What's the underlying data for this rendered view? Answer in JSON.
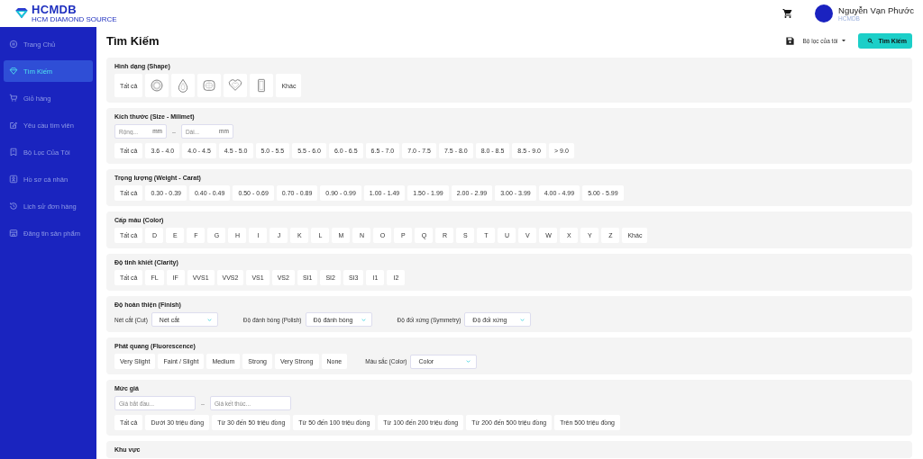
{
  "header": {
    "logo_text": "HCMDB",
    "logo_tagline": "HCM DIAMOND SOURCE",
    "user_name": "Nguyễn Vạn Phước",
    "user_org": "HCMDB"
  },
  "sidebar": {
    "items": [
      {
        "label": "Trang Chủ",
        "selected": false
      },
      {
        "label": "Tìm Kiếm",
        "selected": true
      },
      {
        "label": "Giỏ hàng",
        "selected": false
      },
      {
        "label": "Yêu cầu tìm viên",
        "selected": false
      },
      {
        "label": "Bộ Lọc Của Tôi",
        "selected": false
      },
      {
        "label": "Hồ sơ cá nhân",
        "selected": false
      },
      {
        "label": "Lịch sử đơn hàng",
        "selected": false
      },
      {
        "label": "Đăng tin sản phẩm",
        "selected": false
      }
    ]
  },
  "page": {
    "title": "Tìm Kiếm",
    "filters_menu": "Bộ lọc của tôi",
    "search_button": "Tìm Kiếm"
  },
  "sections": [
    {
      "title": "Hình dạng (Shape)",
      "options": [
        {
          "kind": "text",
          "label": "Tất cả"
        },
        {
          "kind": "icon"
        },
        {
          "kind": "icon"
        },
        {
          "kind": "icon"
        },
        {
          "kind": "icon"
        },
        {
          "kind": "icon"
        },
        {
          "kind": "text",
          "label": "Khác"
        }
      ]
    },
    {
      "title": "Kích thước (Size - Milimet)",
      "inputs": [
        {
          "placeholder": "Rộng...",
          "unit": "mm"
        },
        {
          "placeholder": "Dài...",
          "unit": "mm"
        }
      ],
      "separator": "–",
      "options": [
        {
          "kind": "text",
          "label": "Tất cả"
        },
        {
          "kind": "text",
          "label": "3.6 - 4.0"
        },
        {
          "kind": "text",
          "label": "4.0 - 4.5"
        },
        {
          "kind": "text",
          "label": "4.5 - 5.0"
        },
        {
          "kind": "text",
          "label": "5.0 - 5.5"
        },
        {
          "kind": "text",
          "label": "5.5 - 6.0"
        },
        {
          "kind": "text",
          "label": "6.0 - 6.5"
        },
        {
          "kind": "text",
          "label": "6.5 - 7.0"
        },
        {
          "kind": "text",
          "label": "7.0 - 7.5"
        },
        {
          "kind": "text",
          "label": "7.5 - 8.0"
        },
        {
          "kind": "text",
          "label": "8.0 - 8.5"
        },
        {
          "kind": "text",
          "label": "8.5 - 9.0"
        },
        {
          "kind": "text",
          "label": "> 9.0"
        }
      ]
    },
    {
      "title": "Trọng lượng (Weight - Carat)",
      "options": [
        {
          "kind": "text",
          "label": "Tất cả"
        },
        {
          "kind": "text",
          "label": "0.30 - 0.39"
        },
        {
          "kind": "text",
          "label": "0.40 - 0.49"
        },
        {
          "kind": "text",
          "label": "0.50 - 0.69"
        },
        {
          "kind": "text",
          "label": "0.70 - 0.89"
        },
        {
          "kind": "text",
          "label": "0.90 - 0.99"
        },
        {
          "kind": "text",
          "label": "1.00 - 1.49"
        },
        {
          "kind": "text",
          "label": "1.50 - 1.99"
        },
        {
          "kind": "text",
          "label": "2.00 - 2.99"
        },
        {
          "kind": "text",
          "label": "3.00 - 3.99"
        },
        {
          "kind": "text",
          "label": "4.00 - 4.99"
        },
        {
          "kind": "text",
          "label": "5.00 - 5.99"
        }
      ]
    },
    {
      "title": "Cấp màu (Color)",
      "options": [
        {
          "kind": "text",
          "label": "Tất cả"
        },
        {
          "kind": "text",
          "label": "D"
        },
        {
          "kind": "text",
          "label": "E"
        },
        {
          "kind": "text",
          "label": "F"
        },
        {
          "kind": "text",
          "label": "G"
        },
        {
          "kind": "text",
          "label": "H"
        },
        {
          "kind": "text",
          "label": "I"
        },
        {
          "kind": "text",
          "label": "J"
        },
        {
          "kind": "text",
          "label": "K"
        },
        {
          "kind": "text",
          "label": "L"
        },
        {
          "kind": "text",
          "label": "M"
        },
        {
          "kind": "text",
          "label": "N"
        },
        {
          "kind": "text",
          "label": "O"
        },
        {
          "kind": "text",
          "label": "P"
        },
        {
          "kind": "text",
          "label": "Q"
        },
        {
          "kind": "text",
          "label": "R"
        },
        {
          "kind": "text",
          "label": "S"
        },
        {
          "kind": "text",
          "label": "T"
        },
        {
          "kind": "text",
          "label": "U"
        },
        {
          "kind": "text",
          "label": "V"
        },
        {
          "kind": "text",
          "label": "W"
        },
        {
          "kind": "text",
          "label": "X"
        },
        {
          "kind": "text",
          "label": "Y"
        },
        {
          "kind": "text",
          "label": "Z"
        },
        {
          "kind": "text",
          "label": "Khác"
        }
      ]
    },
    {
      "title": "Độ tinh khiết (Clarity)",
      "options": [
        {
          "kind": "text",
          "label": "Tất cả"
        },
        {
          "kind": "text",
          "label": "FL"
        },
        {
          "kind": "text",
          "label": "IF"
        },
        {
          "kind": "text",
          "label": "VVS1"
        },
        {
          "kind": "text",
          "label": "VVS2"
        },
        {
          "kind": "text",
          "label": "VS1"
        },
        {
          "kind": "text",
          "label": "VS2"
        },
        {
          "kind": "text",
          "label": "SI1"
        },
        {
          "kind": "text",
          "label": "SI2"
        },
        {
          "kind": "text",
          "label": "SI3"
        },
        {
          "kind": "text",
          "label": "I1"
        },
        {
          "kind": "text",
          "label": "I2"
        }
      ]
    },
    {
      "title": "Độ hoàn thiện (Finish)",
      "selects": [
        {
          "label": "Nét cắt (Cut)",
          "value": "Nét cắt"
        },
        {
          "label": "Độ đánh bóng (Polish)",
          "value": "Độ đánh bóng"
        },
        {
          "label": "Độ đối xứng (Symmetry)",
          "value": "Độ đối xứng"
        }
      ]
    },
    {
      "title": "Phát quang (Fluorescence)",
      "options": [
        {
          "kind": "text",
          "label": "Very Slight"
        },
        {
          "kind": "text",
          "label": "Faint / Slight"
        },
        {
          "kind": "text",
          "label": "Medium"
        },
        {
          "kind": "text",
          "label": "Strong"
        },
        {
          "kind": "text",
          "label": "Very Strong"
        },
        {
          "kind": "text",
          "label": "None"
        }
      ],
      "selects": [
        {
          "label": "Màu sắc (Color)",
          "value": "Color"
        }
      ]
    },
    {
      "title": "Mức giá",
      "inputs": [
        {
          "placeholder": "Giá bắt đầu..."
        },
        {
          "placeholder": "Giá kết thúc..."
        }
      ],
      "separator": "–",
      "options": [
        {
          "kind": "text",
          "label": "Tất cả"
        },
        {
          "kind": "text",
          "label": "Dưới 30 triệu đồng"
        },
        {
          "kind": "text",
          "label": "Từ 30 đến 50 triệu đồng"
        },
        {
          "kind": "text",
          "label": "Từ 50 đến 100 triệu đồng"
        },
        {
          "kind": "text",
          "label": "Từ 100 đến 200 triệu đồng"
        },
        {
          "kind": "text",
          "label": "Từ 200 đến 500 triệu đồng"
        },
        {
          "kind": "text",
          "label": "Trên 500 triệu đồng"
        }
      ]
    },
    {
      "title": "Khu vực"
    }
  ]
}
